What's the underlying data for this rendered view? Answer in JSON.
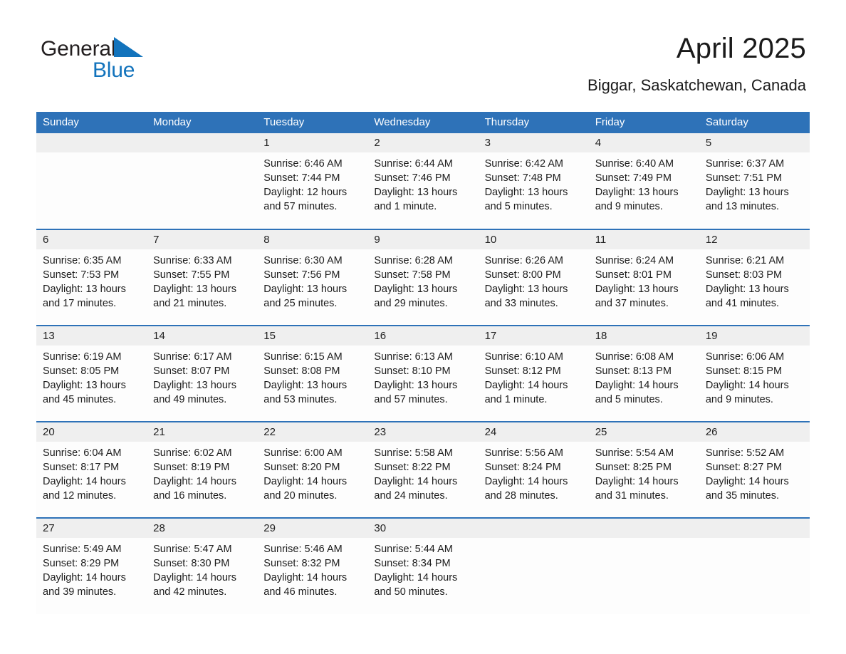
{
  "brand": {
    "name_part1": "General",
    "name_part2": "Blue",
    "accent_color": "#1273bc"
  },
  "header": {
    "title": "April 2025",
    "location": "Biggar, Saskatchewan, Canada"
  },
  "theme": {
    "header_blue": "#2e72b8",
    "daynum_band": "#efefef",
    "cell_bg": "#fdfdfd"
  },
  "weekdays": [
    "Sunday",
    "Monday",
    "Tuesday",
    "Wednesday",
    "Thursday",
    "Friday",
    "Saturday"
  ],
  "labels": {
    "sunrise_prefix": "Sunrise:",
    "sunset_prefix": "Sunset:",
    "daylight_prefix": "Daylight:"
  },
  "weeks": [
    [
      {
        "day": "",
        "blank": true
      },
      {
        "day": "",
        "blank": true
      },
      {
        "day": "1",
        "sunrise": "Sunrise: 6:46 AM",
        "sunset": "Sunset: 7:44 PM",
        "daylight": "Daylight: 12 hours and 57 minutes."
      },
      {
        "day": "2",
        "sunrise": "Sunrise: 6:44 AM",
        "sunset": "Sunset: 7:46 PM",
        "daylight": "Daylight: 13 hours and 1 minute."
      },
      {
        "day": "3",
        "sunrise": "Sunrise: 6:42 AM",
        "sunset": "Sunset: 7:48 PM",
        "daylight": "Daylight: 13 hours and 5 minutes."
      },
      {
        "day": "4",
        "sunrise": "Sunrise: 6:40 AM",
        "sunset": "Sunset: 7:49 PM",
        "daylight": "Daylight: 13 hours and 9 minutes."
      },
      {
        "day": "5",
        "sunrise": "Sunrise: 6:37 AM",
        "sunset": "Sunset: 7:51 PM",
        "daylight": "Daylight: 13 hours and 13 minutes."
      }
    ],
    [
      {
        "day": "6",
        "sunrise": "Sunrise: 6:35 AM",
        "sunset": "Sunset: 7:53 PM",
        "daylight": "Daylight: 13 hours and 17 minutes."
      },
      {
        "day": "7",
        "sunrise": "Sunrise: 6:33 AM",
        "sunset": "Sunset: 7:55 PM",
        "daylight": "Daylight: 13 hours and 21 minutes."
      },
      {
        "day": "8",
        "sunrise": "Sunrise: 6:30 AM",
        "sunset": "Sunset: 7:56 PM",
        "daylight": "Daylight: 13 hours and 25 minutes."
      },
      {
        "day": "9",
        "sunrise": "Sunrise: 6:28 AM",
        "sunset": "Sunset: 7:58 PM",
        "daylight": "Daylight: 13 hours and 29 minutes."
      },
      {
        "day": "10",
        "sunrise": "Sunrise: 6:26 AM",
        "sunset": "Sunset: 8:00 PM",
        "daylight": "Daylight: 13 hours and 33 minutes."
      },
      {
        "day": "11",
        "sunrise": "Sunrise: 6:24 AM",
        "sunset": "Sunset: 8:01 PM",
        "daylight": "Daylight: 13 hours and 37 minutes."
      },
      {
        "day": "12",
        "sunrise": "Sunrise: 6:21 AM",
        "sunset": "Sunset: 8:03 PM",
        "daylight": "Daylight: 13 hours and 41 minutes."
      }
    ],
    [
      {
        "day": "13",
        "sunrise": "Sunrise: 6:19 AM",
        "sunset": "Sunset: 8:05 PM",
        "daylight": "Daylight: 13 hours and 45 minutes."
      },
      {
        "day": "14",
        "sunrise": "Sunrise: 6:17 AM",
        "sunset": "Sunset: 8:07 PM",
        "daylight": "Daylight: 13 hours and 49 minutes."
      },
      {
        "day": "15",
        "sunrise": "Sunrise: 6:15 AM",
        "sunset": "Sunset: 8:08 PM",
        "daylight": "Daylight: 13 hours and 53 minutes."
      },
      {
        "day": "16",
        "sunrise": "Sunrise: 6:13 AM",
        "sunset": "Sunset: 8:10 PM",
        "daylight": "Daylight: 13 hours and 57 minutes."
      },
      {
        "day": "17",
        "sunrise": "Sunrise: 6:10 AM",
        "sunset": "Sunset: 8:12 PM",
        "daylight": "Daylight: 14 hours and 1 minute."
      },
      {
        "day": "18",
        "sunrise": "Sunrise: 6:08 AM",
        "sunset": "Sunset: 8:13 PM",
        "daylight": "Daylight: 14 hours and 5 minutes."
      },
      {
        "day": "19",
        "sunrise": "Sunrise: 6:06 AM",
        "sunset": "Sunset: 8:15 PM",
        "daylight": "Daylight: 14 hours and 9 minutes."
      }
    ],
    [
      {
        "day": "20",
        "sunrise": "Sunrise: 6:04 AM",
        "sunset": "Sunset: 8:17 PM",
        "daylight": "Daylight: 14 hours and 12 minutes."
      },
      {
        "day": "21",
        "sunrise": "Sunrise: 6:02 AM",
        "sunset": "Sunset: 8:19 PM",
        "daylight": "Daylight: 14 hours and 16 minutes."
      },
      {
        "day": "22",
        "sunrise": "Sunrise: 6:00 AM",
        "sunset": "Sunset: 8:20 PM",
        "daylight": "Daylight: 14 hours and 20 minutes."
      },
      {
        "day": "23",
        "sunrise": "Sunrise: 5:58 AM",
        "sunset": "Sunset: 8:22 PM",
        "daylight": "Daylight: 14 hours and 24 minutes."
      },
      {
        "day": "24",
        "sunrise": "Sunrise: 5:56 AM",
        "sunset": "Sunset: 8:24 PM",
        "daylight": "Daylight: 14 hours and 28 minutes."
      },
      {
        "day": "25",
        "sunrise": "Sunrise: 5:54 AM",
        "sunset": "Sunset: 8:25 PM",
        "daylight": "Daylight: 14 hours and 31 minutes."
      },
      {
        "day": "26",
        "sunrise": "Sunrise: 5:52 AM",
        "sunset": "Sunset: 8:27 PM",
        "daylight": "Daylight: 14 hours and 35 minutes."
      }
    ],
    [
      {
        "day": "27",
        "sunrise": "Sunrise: 5:49 AM",
        "sunset": "Sunset: 8:29 PM",
        "daylight": "Daylight: 14 hours and 39 minutes."
      },
      {
        "day": "28",
        "sunrise": "Sunrise: 5:47 AM",
        "sunset": "Sunset: 8:30 PM",
        "daylight": "Daylight: 14 hours and 42 minutes."
      },
      {
        "day": "29",
        "sunrise": "Sunrise: 5:46 AM",
        "sunset": "Sunset: 8:32 PM",
        "daylight": "Daylight: 14 hours and 46 minutes."
      },
      {
        "day": "30",
        "sunrise": "Sunrise: 5:44 AM",
        "sunset": "Sunset: 8:34 PM",
        "daylight": "Daylight: 14 hours and 50 minutes."
      },
      {
        "day": "",
        "blank": true
      },
      {
        "day": "",
        "blank": true
      },
      {
        "day": "",
        "blank": true
      }
    ]
  ]
}
